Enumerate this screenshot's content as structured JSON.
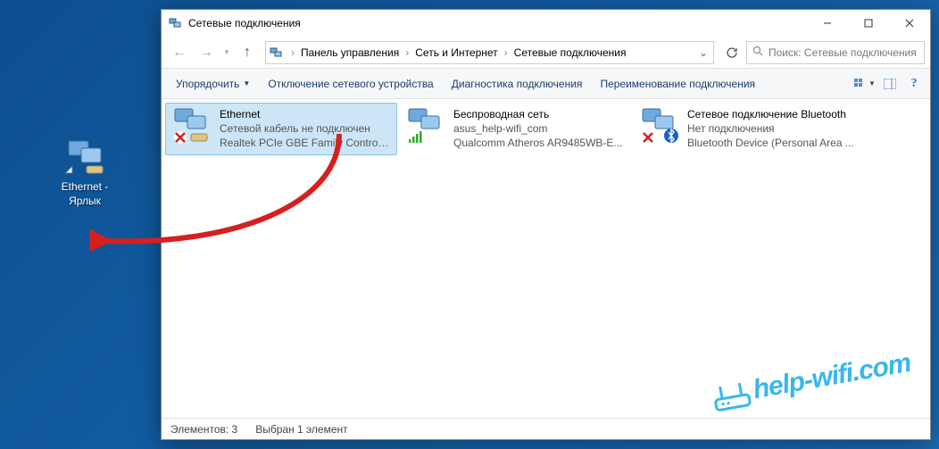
{
  "desktop": {
    "shortcut_label": "Ethernet - Ярлык"
  },
  "window": {
    "title": "Сетевые подключения",
    "breadcrumb": {
      "root": "Панель управления",
      "middle": "Сеть и Интернет",
      "leaf": "Сетевые подключения"
    },
    "search_placeholder": "Поиск: Сетевые подключения",
    "commands": {
      "organize": "Упорядочить",
      "disable": "Отключение сетевого устройства",
      "diagnose": "Диагностика подключения",
      "rename": "Переименование подключения"
    },
    "help_glyph": "?",
    "connections": [
      {
        "name": "Ethernet",
        "status": "Сетевой кабель не подключен",
        "device": "Realtek PCIe GBE Family Controller",
        "selected": true,
        "badge": "x"
      },
      {
        "name": "Беспроводная сеть",
        "status": "asus_help-wifi_com",
        "device": "Qualcomm Atheros AR9485WB-E...",
        "selected": false,
        "badge": "bars"
      },
      {
        "name": "Сетевое подключение Bluetooth",
        "status": "Нет подключения",
        "device": "Bluetooth Device (Personal Area ...",
        "selected": false,
        "badge": "bt"
      }
    ],
    "statusbar": {
      "count_label": "Элементов: 3",
      "selected_label": "Выбран 1 элемент"
    }
  },
  "watermark": "help-wifi.com"
}
